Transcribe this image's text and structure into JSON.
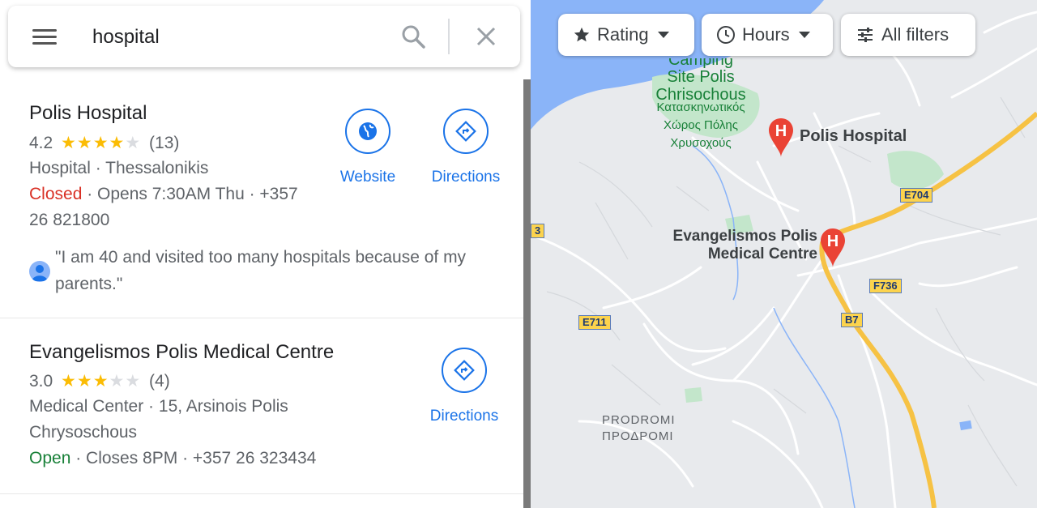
{
  "search": {
    "query": "hospital"
  },
  "results": [
    {
      "name": "Polis Hospital",
      "rating": "4.2",
      "rating_value": 4.2,
      "review_count": "(13)",
      "category_address": "Hospital · Thessalonikis",
      "status": "Closed",
      "status_detail": " · Opens 7:30AM Thu · +357",
      "phone_cont": "26 821800",
      "quote": "\"I am 40 and visited too many hospitals because of my parents.\"",
      "website_label": "Website",
      "directions_label": "Directions"
    },
    {
      "name": "Evangelismos Polis Medical Centre",
      "rating": "3.0",
      "rating_value": 3.0,
      "review_count": "(4)",
      "category_address": "Medical Center · 15, Arsinois Polis",
      "address_cont": "Chrysoschous",
      "status": "Open",
      "status_detail": " · Closes 8PM · +357 26 323434",
      "directions_label": "Directions"
    }
  ],
  "filters": {
    "rating": "Rating",
    "hours": "Hours",
    "all_filters": "All filters"
  },
  "map": {
    "labels": {
      "campsite_line1": "Camping",
      "campsite_line2": "Site Polis",
      "campsite_line3": "Chrisochous",
      "campsite_greek1": "Κατασκηνωτικός",
      "campsite_greek2": "Χώρος Πόλης",
      "campsite_greek3": "Χρυσοχούς",
      "hospital_pin": "Polis Hospital",
      "medical_line1": "Evangelismos Polis",
      "medical_line2": "Medical Centre",
      "prodromi": "PRODROMI",
      "prodromi_greek": "ΠΡΟΔΡΟΜΙ"
    },
    "roads": {
      "e704": "E704",
      "f736": "F736",
      "b7": "B7",
      "e711": "E711",
      "edge": "3"
    }
  },
  "colors": {
    "accent": "#1a73e8",
    "closed": "#d93025",
    "open": "#188038",
    "star": "#fbbc04",
    "pin": "#ea4335",
    "water": "#8ab4f8",
    "park": "#c3e6cb",
    "highway": "#f6c244"
  }
}
